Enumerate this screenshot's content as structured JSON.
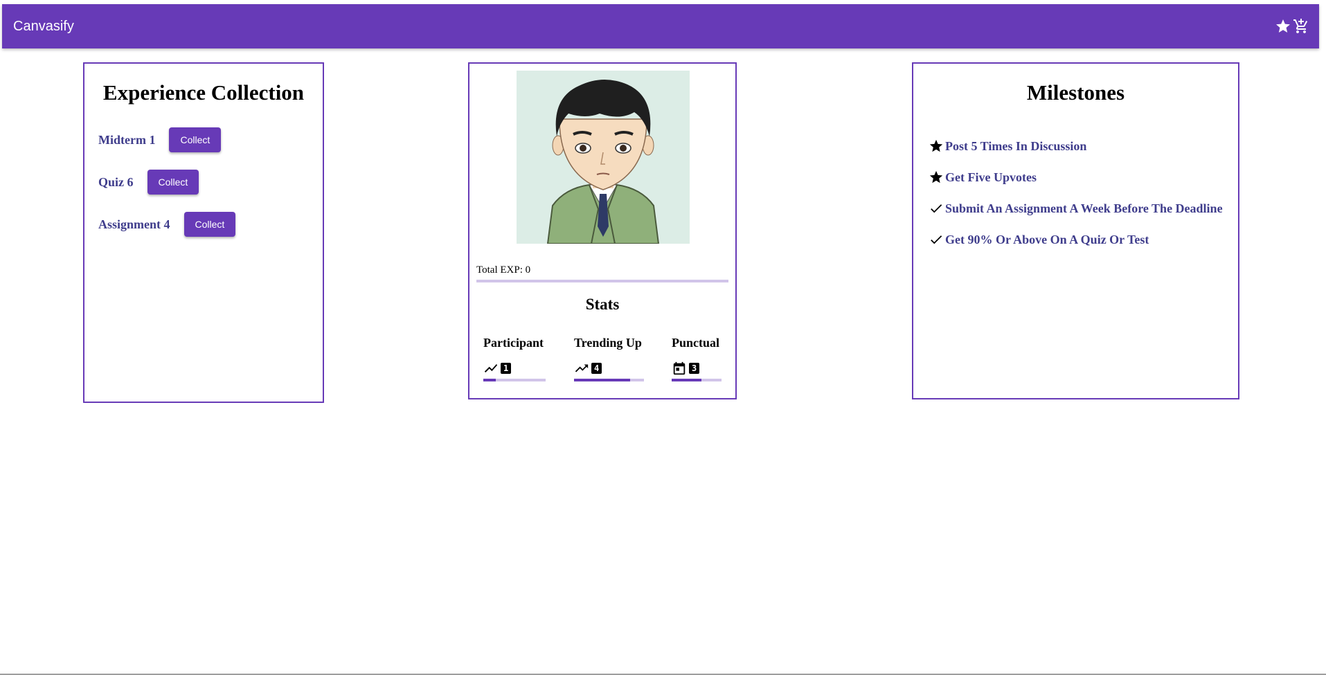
{
  "appbar": {
    "title": "Canvasify",
    "icons": [
      "star-icon",
      "cart-icon"
    ]
  },
  "experience": {
    "heading": "Experience Collection",
    "items": [
      {
        "label": "Midterm 1",
        "button": "Collect"
      },
      {
        "label": "Quiz 6",
        "button": "Collect"
      },
      {
        "label": "Assignment 4",
        "button": "Collect"
      }
    ]
  },
  "profile": {
    "total_exp_label": "Total EXP: 0",
    "total_exp_progress": 0,
    "stats_heading": "Stats",
    "stats": [
      {
        "name": "Participant",
        "icon": "trending-icon",
        "value": "1",
        "progress": 0.2
      },
      {
        "name": "Trending Up",
        "icon": "trending-up-icon",
        "value": "4",
        "progress": 0.8
      },
      {
        "name": "Punctual",
        "icon": "calendar-icon",
        "value": "3",
        "progress": 0.6
      }
    ]
  },
  "milestones": {
    "heading": "Milestones",
    "items": [
      {
        "label": "Post 5 Times In Discussion",
        "icon": "star-icon"
      },
      {
        "label": "Get Five Upvotes",
        "icon": "star-icon"
      },
      {
        "label": "Submit An Assignment A Week Before The Deadline",
        "icon": "check-icon"
      },
      {
        "label": "Get 90% Or Above On A Quiz Or Test",
        "icon": "check-icon"
      }
    ]
  },
  "colors": {
    "primary": "#673ab7",
    "primary_light": "#d1c4e9",
    "label_text": "#3f3d8c"
  }
}
